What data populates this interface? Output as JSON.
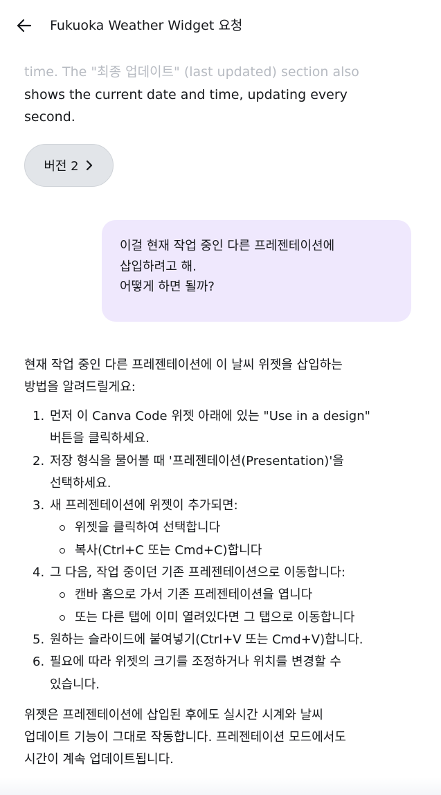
{
  "header": {
    "back_icon": "arrow-left-icon",
    "title": "Fukuoka Weather Widget 요청"
  },
  "previous_message": {
    "faded_line": "time. The \"최종 업데이트\" (last updated) section also",
    "lines": [
      "shows the current date and time, updating every",
      "second."
    ]
  },
  "version_button": {
    "label": "버전 2",
    "icon": "chevron-right-icon"
  },
  "user_message": {
    "lines": [
      "이걸 현재 작업 중인 다른 프레젠테이션에",
      "삽입하려고 해.",
      "어떻게 하면 될까?"
    ]
  },
  "reply": {
    "intro_lines": [
      "현재 작업 중인 다른 프레젠테이션에 이 날씨 위젯을 삽입하는",
      "방법을 알려드릴게요:"
    ],
    "steps": [
      {
        "num": "1.",
        "lines": [
          "먼저 이 Canva Code 위젯 아래에 있는 \"Use in a design\"",
          "버튼을 클릭하세요."
        ],
        "subs": []
      },
      {
        "num": "2.",
        "lines": [
          "저장 형식을 물어볼 때 '프레젠테이션(Presentation)'을",
          "선택하세요."
        ],
        "subs": []
      },
      {
        "num": "3.",
        "lines": [
          "새 프레젠테이션에 위젯이 추가되면:"
        ],
        "subs": [
          "위젯을 클릭하여 선택합니다",
          "복사(Ctrl+C 또는 Cmd+C)합니다"
        ]
      },
      {
        "num": "4.",
        "lines": [
          "그 다음, 작업 중이던 기존 프레젠테이션으로 이동합니다:"
        ],
        "subs": [
          "캔바 홈으로 가서 기존 프레젠테이션을 엽니다",
          "또는 다른 탭에 이미 열려있다면 그 탭으로 이동합니다"
        ]
      },
      {
        "num": "5.",
        "lines": [
          "원하는 슬라이드에 붙여넣기(Ctrl+V 또는 Cmd+V)합니다."
        ],
        "subs": []
      },
      {
        "num": "6.",
        "lines": [
          "필요에 따라 위젯의 크기를 조정하거나 위치를 변경할 수",
          "있습니다."
        ],
        "subs": []
      }
    ],
    "closing_lines": [
      "위젯은 프레젠테이션에 삽입된 후에도 실시간 시계와 날씨",
      "업데이트 기능이 그대로 작동합니다. 프레젠테이션 모드에서도",
      "시간이 계속 업데이트됩니다."
    ]
  }
}
